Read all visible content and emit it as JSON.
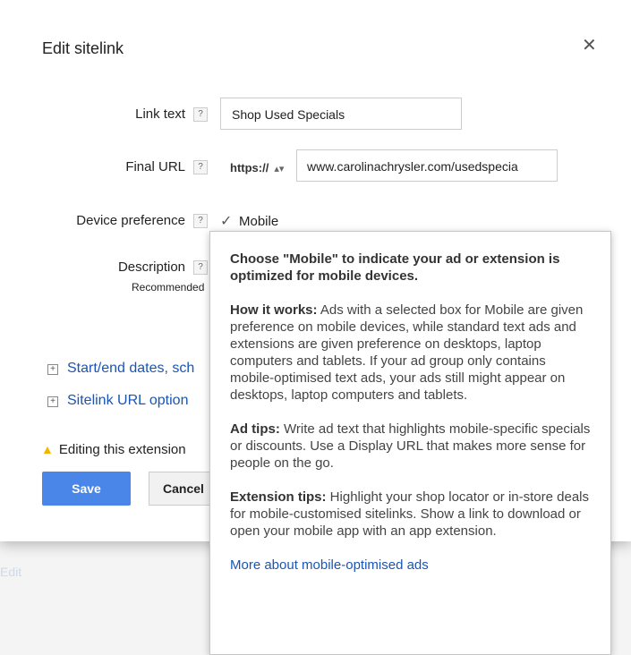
{
  "background": {
    "edit_link": "Edit"
  },
  "dialog": {
    "title": "Edit sitelink",
    "close_symbol": "✕",
    "fields": {
      "link_text": {
        "label": "Link text",
        "value": "Shop Used Specials"
      },
      "final_url": {
        "label": "Final URL",
        "protocol": "https://",
        "value": "www.carolinachrysler.com/usedspecia"
      },
      "device_preference": {
        "label": "Device preference",
        "checkbox_label": "Mobile",
        "checked": true
      },
      "description": {
        "label": "Description",
        "note": "Recommended"
      }
    },
    "help_symbol": "?",
    "expanders": {
      "dates": "Start/end dates, sch",
      "url_options": "Sitelink URL option"
    },
    "warning": "Editing this extension",
    "buttons": {
      "save": "Save",
      "cancel": "Cancel"
    }
  },
  "tooltip": {
    "lead": "Choose \"Mobile\" to indicate your ad or extension is optimized for mobile devices.",
    "how_title": "How it works:",
    "how_body": " Ads with a selected box for Mobile are given preference on mobile devices, while standard text ads and extensions are given preference on desktops, laptop computers and tablets. If your ad group only contains mobile-optimised text ads, your ads still might appear on desktops, laptop computers and tablets.",
    "ad_title": "Ad tips:",
    "ad_body": " Write ad text that highlights mobile-specific specials or discounts. Use a Display URL that makes more sense for people on the go.",
    "ext_title": "Extension tips:",
    "ext_body": " Highlight your shop locator or in-store deals for mobile-customised sitelinks. Show a link to download or open your mobile app with an app extension.",
    "link": "More about mobile-optimised ads"
  },
  "colors": {
    "save_button": "#4a86e8",
    "link": "#1a55b5",
    "warning_icon": "#f4b400"
  },
  "icons": [
    "close-icon",
    "help-icon",
    "checkmark-icon",
    "expand-icon",
    "warning-icon",
    "select-arrows-icon"
  ]
}
